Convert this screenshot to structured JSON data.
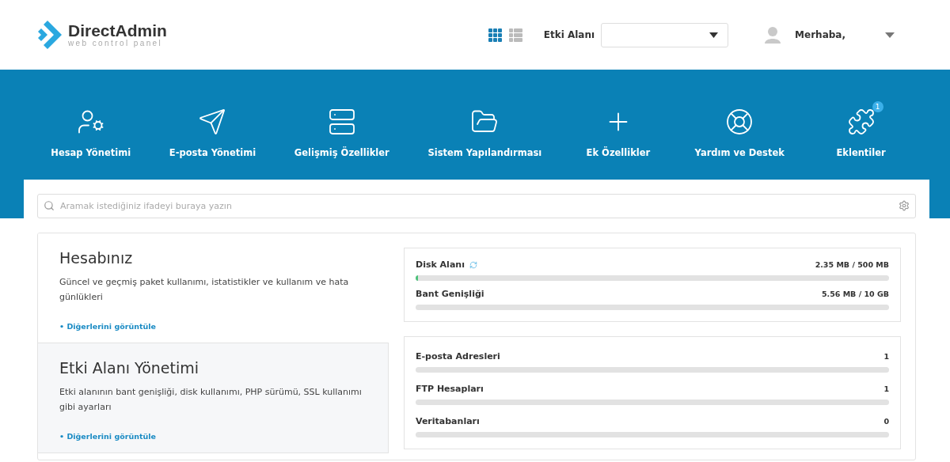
{
  "logo": {
    "name": "DirectAdmin",
    "tagline": "web control panel"
  },
  "view_toggle": [
    {
      "kind": "grid",
      "selected": true
    },
    {
      "kind": "list",
      "selected": false
    }
  ],
  "domain_select": {
    "label": "Etki Alanı"
  },
  "user": {
    "greeting": "Merhaba,"
  },
  "nav": [
    {
      "kind": "account",
      "label": "Hesap Yönetimi"
    },
    {
      "kind": "email",
      "label": "E-posta Yönetimi"
    },
    {
      "kind": "advanced",
      "label": "Gelişmiş Özellikler"
    },
    {
      "kind": "system",
      "label": "Sistem Yapılandırması"
    },
    {
      "kind": "extra",
      "label": "Ek Özellikler"
    },
    {
      "kind": "support",
      "label": "Yardım ve Destek"
    },
    {
      "kind": "plugins",
      "label": "Eklentiler",
      "badge": "1"
    }
  ],
  "search": {
    "placeholder": "Aramak istediğiniz ifadeyi buraya yazın"
  },
  "sections": [
    {
      "title": "Hesabınız",
      "description": "Güncel ve geçmiş paket kullanımı, istatistikler ve kullanım ve hata günlükleri",
      "link": "• Diğerlerini görüntüle",
      "selected": false
    },
    {
      "title": "Etki Alanı Yönetimi",
      "description": "Etki alanının bant genişliği, disk kullanımı, PHP sürümü, SSL kullanımı gibi ayarları",
      "link": "• Diğerlerini görüntüle",
      "selected": true
    }
  ],
  "usage": [
    {
      "label": "Disk Alanı",
      "reading": "2.35 MB / 500 MB",
      "level": 0.005,
      "refresh": true
    },
    {
      "label": "Bant Genişliği",
      "reading": "5.56 MB / 10 GB",
      "level": 0,
      "refresh": false
    }
  ],
  "counts": [
    {
      "label": "E-posta Adresleri",
      "reading": "1",
      "level": 0
    },
    {
      "label": "FTP Hesapları",
      "reading": "1",
      "level": 0
    },
    {
      "label": "Veritabanları",
      "reading": "0",
      "level": 0
    }
  ]
}
